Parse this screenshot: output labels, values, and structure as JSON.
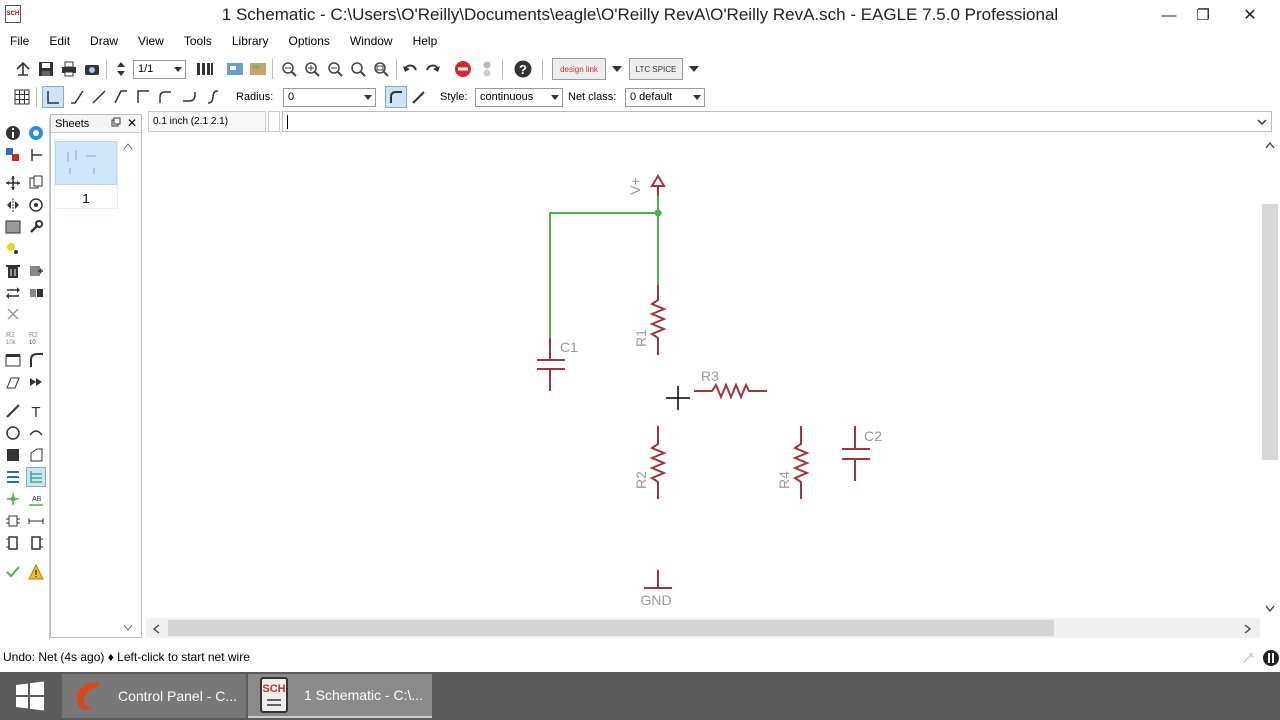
{
  "window": {
    "title": "1 Schematic - C:\\Users\\O'Reilly\\Documents\\eagle\\O'Reilly RevA\\O'Reilly RevA.sch - EAGLE 7.5.0 Professional",
    "app_icon_text": "SCH",
    "minimize": "—",
    "maximize": "❐",
    "close": "✕"
  },
  "menu": [
    "File",
    "Edit",
    "Draw",
    "View",
    "Tools",
    "Library",
    "Options",
    "Window",
    "Help"
  ],
  "toolbar1": {
    "sheet_select": "1/1",
    "designlink_label": "design link",
    "ltspice_label": "LTC SPICE"
  },
  "toolbar2": {
    "radius_label": "Radius:",
    "radius_value": "0",
    "style_label": "Style:",
    "style_value": "continuous",
    "netclass_label": "Net class:",
    "netclass_value": "0 default"
  },
  "command": {
    "coordinate": "0.1 inch (2.1 2.1)",
    "input_value": ""
  },
  "sheets": {
    "title": "Sheets",
    "items": [
      {
        "label": "1"
      }
    ]
  },
  "schematic": {
    "labels": {
      "vplus": "V+",
      "r1": "R1",
      "r2": "R2",
      "r3": "R3",
      "r4": "R4",
      "c1": "C1",
      "c2": "C2",
      "gnd": "GND"
    },
    "colors": {
      "symbol": "#a0363d",
      "net": "#4caf50",
      "label": "#9a9a9a"
    }
  },
  "status": {
    "text": "Undo: Net (4s ago) ♦ Left-click to start net wire"
  },
  "taskbar": {
    "items": [
      {
        "label": "Control Panel - C..."
      },
      {
        "label": "1 Schematic - C:\\..."
      }
    ],
    "sch_icon_text": "SCH"
  }
}
